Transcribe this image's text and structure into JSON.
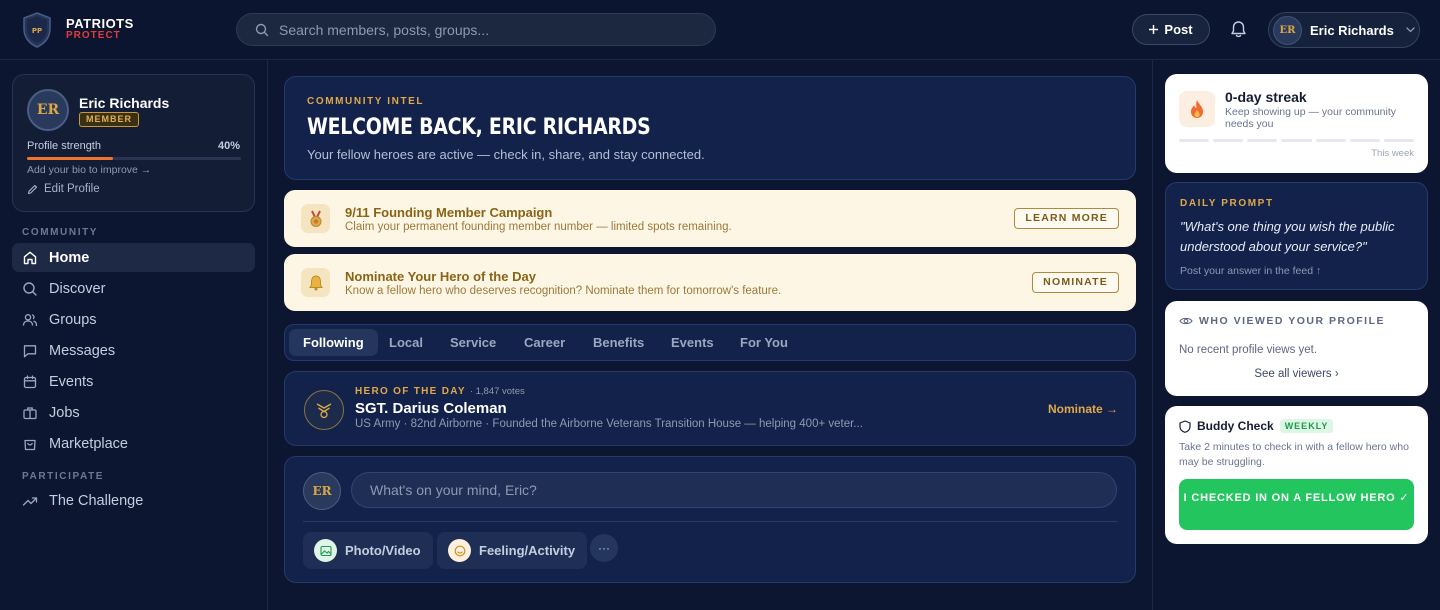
{
  "header": {
    "logo_line1": "PATRIOTS",
    "logo_line2": "PROTECT",
    "logo_initials": "PP",
    "search_placeholder": "Search members, posts, groups...",
    "post_label": "Post",
    "user_initials": "ER",
    "user_name": "Eric Richards"
  },
  "profile": {
    "initials": "ER",
    "name": "Eric Richards",
    "badge": "MEMBER",
    "strength_label": "Profile strength",
    "strength_pct": "40%",
    "strength_value": 0.4,
    "hint": "Add your bio to improve →",
    "edit_label": "Edit Profile"
  },
  "nav": {
    "community_label": "COMMUNITY",
    "items": [
      {
        "label": "Home",
        "icon": "home-icon"
      },
      {
        "label": "Discover",
        "icon": "search-icon"
      },
      {
        "label": "Groups",
        "icon": "users-icon"
      },
      {
        "label": "Messages",
        "icon": "message-icon"
      },
      {
        "label": "Events",
        "icon": "calendar-icon"
      },
      {
        "label": "Jobs",
        "icon": "briefcase-icon"
      },
      {
        "label": "Marketplace",
        "icon": "shopping-bag-icon"
      }
    ],
    "participate_label": "PARTICIPATE",
    "challenge_label": "The Challenge"
  },
  "welcome": {
    "kicker": "COMMUNITY INTEL",
    "title": "WELCOME BACK, ERIC RICHARDS",
    "subtitle": "Your fellow heroes are active — check in, share, and stay connected."
  },
  "banners": [
    {
      "title": "9/11 Founding Member Campaign",
      "subtitle": "Claim your permanent founding member number — limited spots remaining.",
      "button": "LEARN MORE",
      "icon": "medal-icon"
    },
    {
      "title": "Nominate Your Hero of the Day",
      "subtitle": "Know a fellow hero who deserves recognition? Nominate them for tomorrow's feature.",
      "button": "NOMINATE",
      "icon": "bell-icon"
    }
  ],
  "tabs": [
    "Following",
    "Local",
    "Service",
    "Career",
    "Benefits",
    "Events",
    "For You"
  ],
  "hero": {
    "kicker": "HERO OF THE DAY",
    "votes": "· 1,847 votes",
    "name": "SGT. Darius Coleman",
    "description": "US Army · 82nd Airborne · Founded the Airborne Veterans Transition House — helping 400+ veter...",
    "nominate": "Nominate →"
  },
  "composer": {
    "initials": "ER",
    "placeholder": "What's on your mind, Eric?",
    "photo_label": "Photo/Video",
    "feeling_label": "Feeling/Activity",
    "more_label": "···"
  },
  "streak": {
    "title": "0-day streak",
    "subtitle": "Keep showing up — your community needs you",
    "week_label": "This week",
    "days": 7,
    "icon": "flame-icon"
  },
  "daily_prompt": {
    "kicker": "DAILY PROMPT",
    "quote": "\"What's one thing you wish the public understood about your service?\"",
    "hint": "Post your answer in the feed ↑"
  },
  "viewers": {
    "title": "WHO VIEWED YOUR PROFILE",
    "empty": "No recent profile views yet.",
    "link": "See all viewers ›"
  },
  "buddy": {
    "title": "Buddy Check",
    "badge": "WEEKLY",
    "description": "Take 2 minutes to check in with a fellow hero who may be struggling.",
    "button": "I CHECKED IN ON A FELLOW HERO ✓"
  },
  "colors": {
    "background": "#0c1630",
    "accent_gold": "#e0a848",
    "accent_green": "#22c55e",
    "progress_orange": "#f0742b",
    "brand_red": "#e23b3b"
  }
}
